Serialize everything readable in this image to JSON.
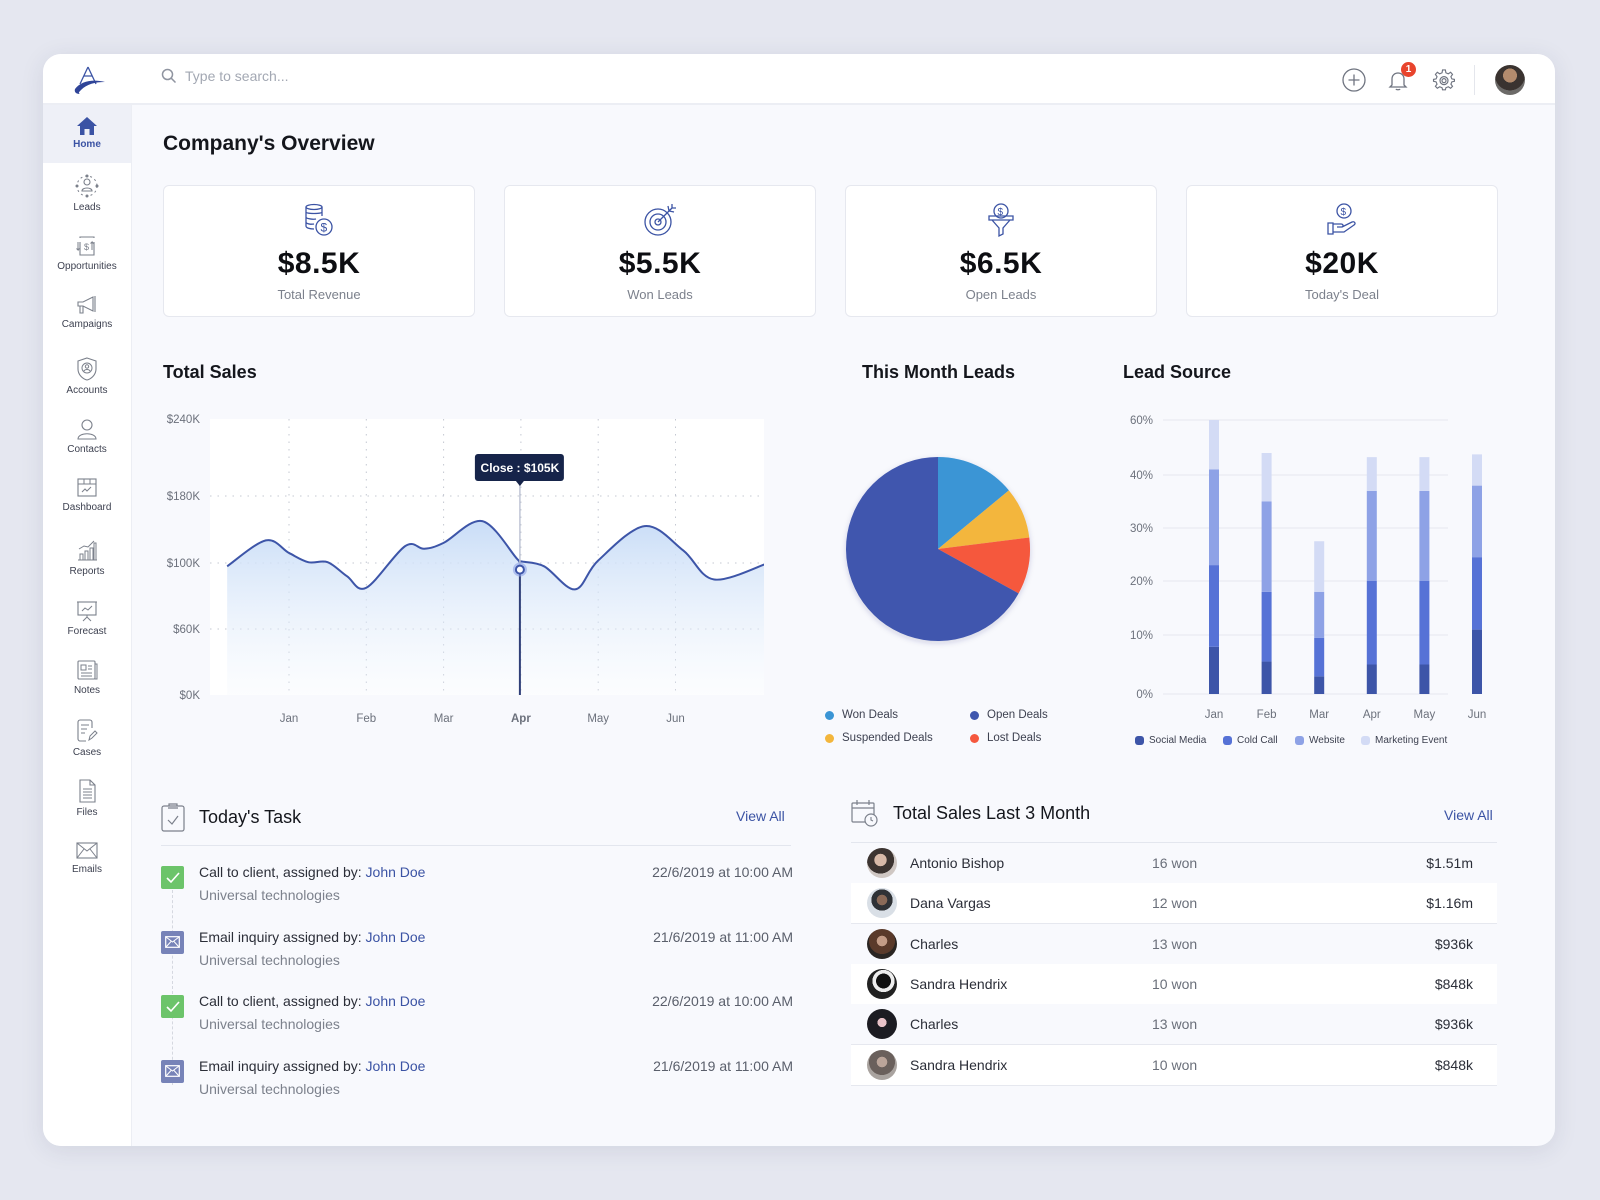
{
  "app": {
    "search_placeholder": "Type to search...",
    "notification_count": "1",
    "colors": {
      "accent": "#3b53a4",
      "navy": "#16244a",
      "success": "#6cc46a",
      "danger": "#e8442d"
    }
  },
  "sidebar": {
    "items": [
      {
        "label": "Home",
        "icon": "home-icon",
        "active": true
      },
      {
        "label": "Leads",
        "icon": "leads-network-icon"
      },
      {
        "label": "Opportunities",
        "icon": "opportunities-icon"
      },
      {
        "label": "Campaigns",
        "icon": "megaphone-icon"
      },
      {
        "label": "Accounts",
        "icon": "shield-user-icon"
      },
      {
        "label": "Contacts",
        "icon": "person-icon"
      },
      {
        "label": "Dashboard",
        "icon": "dashboard-icon"
      },
      {
        "label": "Reports",
        "icon": "reports-icon"
      },
      {
        "label": "Forecast",
        "icon": "presentation-chart-icon"
      },
      {
        "label": "Notes",
        "icon": "notes-icon"
      },
      {
        "label": "Cases",
        "icon": "cases-edit-icon"
      },
      {
        "label": "Files",
        "icon": "file-icon"
      },
      {
        "label": "Emails",
        "icon": "envelope-icon"
      }
    ]
  },
  "page": {
    "title": "Company's Overview"
  },
  "kpis": [
    {
      "value": "$8.5K",
      "label": "Total Revenue",
      "icon": "coins-dollar-icon"
    },
    {
      "value": "$5.5K",
      "label": "Won Leads",
      "icon": "target-icon"
    },
    {
      "value": "$6.5K",
      "label": "Open Leads",
      "icon": "funnel-dollar-icon"
    },
    {
      "value": "$20K",
      "label": "Today's Deal",
      "icon": "hand-dollar-icon"
    }
  ],
  "total_sales": {
    "title": "Total Sales",
    "tooltip": "Close : $105K",
    "selected_month": "Apr"
  },
  "this_month_leads": {
    "title": "This Month Leads"
  },
  "lead_source": {
    "title": "Lead Source"
  },
  "chart_data": [
    {
      "type": "area",
      "title": "Total Sales",
      "xlabel": "",
      "ylabel": "",
      "categories": [
        "Jan",
        "Feb",
        "Mar",
        "Apr",
        "May",
        "Jun"
      ],
      "y_ticks": [
        "$0K",
        "$60K",
        "$100K",
        "$180K",
        "$240K"
      ],
      "ylim": [
        0,
        240
      ],
      "grid": true,
      "x": [
        -0.8,
        -0.3,
        0.0,
        0.25,
        0.5,
        0.75,
        1.0,
        1.5,
        1.75,
        2.0,
        2.5,
        2.95,
        3.0,
        3.3,
        3.7,
        4.0,
        4.6,
        5.1,
        5.5,
        6.2
      ],
      "values": [
        98,
        127,
        112,
        101,
        101,
        92,
        85,
        120,
        117,
        124,
        150,
        105,
        102,
        98,
        84,
        103,
        144,
        115,
        90,
        100
      ],
      "highlight": {
        "x": "Apr",
        "label": "Close : $105K",
        "value": 105
      }
    },
    {
      "type": "pie",
      "title": "This Month Leads",
      "labels": [
        "Won Deals",
        "Suspended Deals",
        "Lost Deals",
        "Open Deals"
      ],
      "values": [
        14,
        9,
        10,
        67
      ],
      "colors": [
        "#3a95d5",
        "#f3b63c",
        "#f5583e",
        "#4057ae"
      ],
      "legend": "bottom"
    },
    {
      "type": "bar",
      "stacked": true,
      "title": "Lead Source",
      "categories": [
        "Jan",
        "Feb",
        "Mar",
        "Apr",
        "May",
        "Jun"
      ],
      "y_ticks": [
        "0%",
        "10%",
        "20%",
        "30%",
        "40%",
        "60%"
      ],
      "series": [
        {
          "name": "Social Media",
          "color": "#3d55a8",
          "values": [
            8,
            5.5,
            3,
            5,
            5,
            11
          ]
        },
        {
          "name": "Cold Call",
          "color": "#5672d6",
          "values": [
            15,
            12.5,
            6.5,
            15,
            15,
            13.5
          ]
        },
        {
          "name": "Website",
          "color": "#8ea2e6",
          "values": [
            19,
            17,
            8.5,
            17,
            17,
            13.5
          ]
        },
        {
          "name": "Marketing Event",
          "color": "#d3dbf5",
          "values": [
            18,
            13,
            9.5,
            9.5,
            9.5,
            9.5
          ]
        }
      ],
      "legend": "bottom"
    }
  ],
  "tasks": {
    "title": "Today's Task",
    "view_all": "View All",
    "items": [
      {
        "type": "call",
        "text": "Call to client, assigned by: ",
        "assignee": "John Doe",
        "company": "Universal technologies",
        "date": "22/6/2019 at 10:00 AM"
      },
      {
        "type": "email",
        "text": "Email inquiry assigned by: ",
        "assignee": "John Doe",
        "company": "Universal technologies",
        "date": "21/6/2019 at 11:00 AM"
      },
      {
        "type": "call",
        "text": "Call to client, assigned by: ",
        "assignee": "John Doe",
        "company": "Universal technologies",
        "date": "22/6/2019 at 10:00 AM"
      },
      {
        "type": "email",
        "text": "Email inquiry assigned by: ",
        "assignee": "John Doe",
        "company": "Universal technologies",
        "date": "21/6/2019 at 11:00 AM"
      }
    ]
  },
  "sales_last_3": {
    "title": "Total Sales Last 3 Month",
    "view_all": "View All",
    "rows": [
      {
        "name": "Antonio Bishop",
        "won": "16 won",
        "amount": "$1.51m"
      },
      {
        "name": "Dana Vargas",
        "won": "12 won",
        "amount": "$1.16m"
      },
      {
        "name": "Charles",
        "won": "13 won",
        "amount": "$936k"
      },
      {
        "name": "Sandra Hendrix",
        "won": "10 won",
        "amount": "$848k"
      },
      {
        "name": "Charles",
        "won": "13 won",
        "amount": "$936k"
      },
      {
        "name": "Sandra Hendrix",
        "won": "10 won",
        "amount": "$848k"
      }
    ]
  }
}
